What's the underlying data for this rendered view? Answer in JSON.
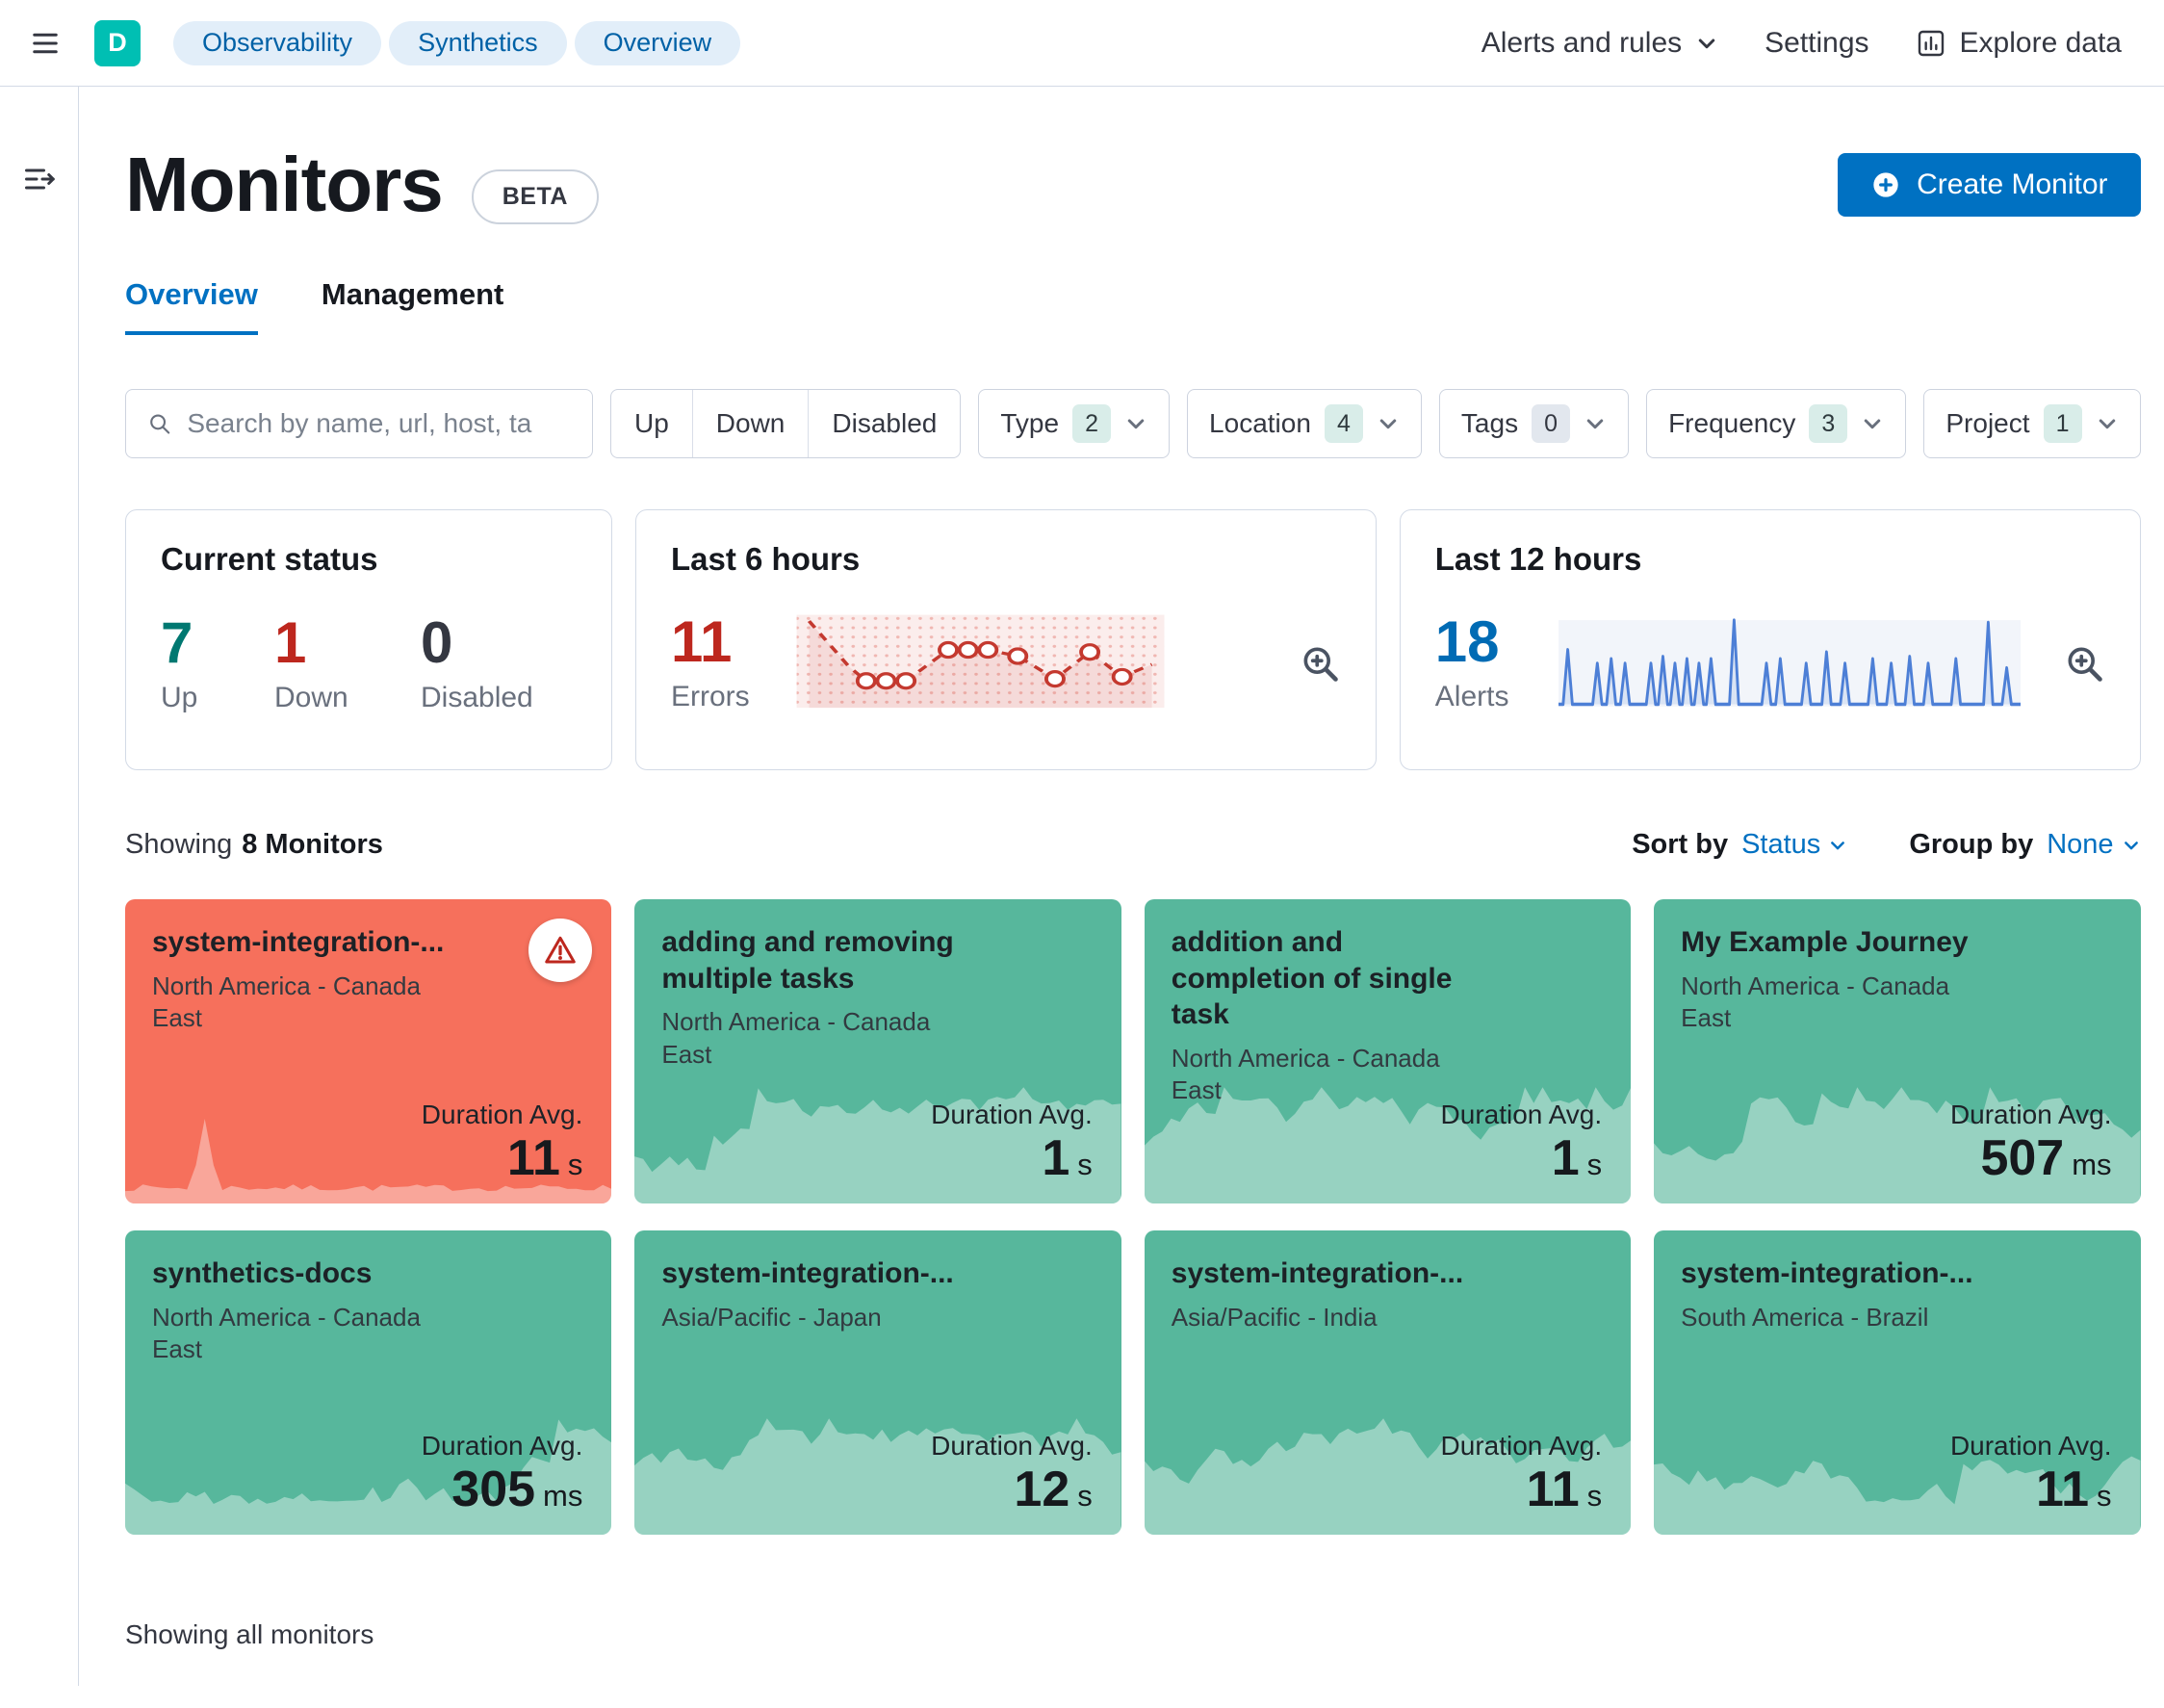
{
  "topbar": {
    "workspace_badge": "D",
    "breadcrumbs": [
      "Observability",
      "Synthetics",
      "Overview"
    ],
    "alerts_menu": "Alerts and rules",
    "settings": "Settings",
    "explore_data": "Explore data"
  },
  "header": {
    "title": "Monitors",
    "beta_badge": "BETA",
    "create_button": "Create Monitor"
  },
  "tabs": {
    "overview": "Overview",
    "management": "Management"
  },
  "filters": {
    "search_placeholder": "Search by name, url, host, ta",
    "status_buttons": [
      "Up",
      "Down",
      "Disabled"
    ],
    "dropdowns": [
      {
        "label": "Type",
        "count": "2"
      },
      {
        "label": "Location",
        "count": "4"
      },
      {
        "label": "Tags",
        "count": "0"
      },
      {
        "label": "Frequency",
        "count": "3"
      },
      {
        "label": "Project",
        "count": "1"
      }
    ]
  },
  "stats": {
    "current_status": {
      "title": "Current status",
      "items": [
        {
          "value": "7",
          "label": "Up"
        },
        {
          "value": "1",
          "label": "Down"
        },
        {
          "value": "0",
          "label": "Disabled"
        }
      ]
    },
    "last6": {
      "title": "Last 6 hours",
      "value": "11",
      "label": "Errors"
    },
    "last12": {
      "title": "Last 12 hours",
      "value": "18",
      "label": "Alerts"
    }
  },
  "listing": {
    "showing_prefix": "Showing",
    "showing_count": "8 Monitors",
    "sort_by_label": "Sort by",
    "sort_by_value": "Status",
    "group_by_label": "Group by",
    "group_by_value": "None",
    "footer": "Showing all monitors"
  },
  "labels": {
    "duration_avg": "Duration Avg."
  },
  "monitors": [
    {
      "name": "system-integration-...",
      "location": "North America - Canada East",
      "duration": "11",
      "unit": "s",
      "status": "down"
    },
    {
      "name": "adding and removing multiple tasks",
      "location": "North America - Canada East",
      "duration": "1",
      "unit": "s",
      "status": "up"
    },
    {
      "name": "addition and completion of single task",
      "location": "North America - Canada East",
      "duration": "1",
      "unit": "s",
      "status": "up"
    },
    {
      "name": "My Example Journey",
      "location": "North America - Canada East",
      "duration": "507",
      "unit": "ms",
      "status": "up"
    },
    {
      "name": "synthetics-docs",
      "location": "North America - Canada East",
      "duration": "305",
      "unit": "ms",
      "status": "up"
    },
    {
      "name": "system-integration-...",
      "location": "Asia/Pacific - Japan",
      "duration": "12",
      "unit": "s",
      "status": "up"
    },
    {
      "name": "system-integration-...",
      "location": "Asia/Pacific - India",
      "duration": "11",
      "unit": "s",
      "status": "up"
    },
    {
      "name": "system-integration-...",
      "location": "South America - Brazil",
      "duration": "11",
      "unit": "s",
      "status": "up"
    }
  ],
  "colors": {
    "primary_blue": "#0071C2",
    "workspace_teal": "#00BFB3",
    "monitor_up_green": "#57B79C",
    "monitor_down_red": "#F6705C",
    "errors_red": "#BD271E",
    "alerts_blue": "#006BB4",
    "success_green": "#007871"
  }
}
